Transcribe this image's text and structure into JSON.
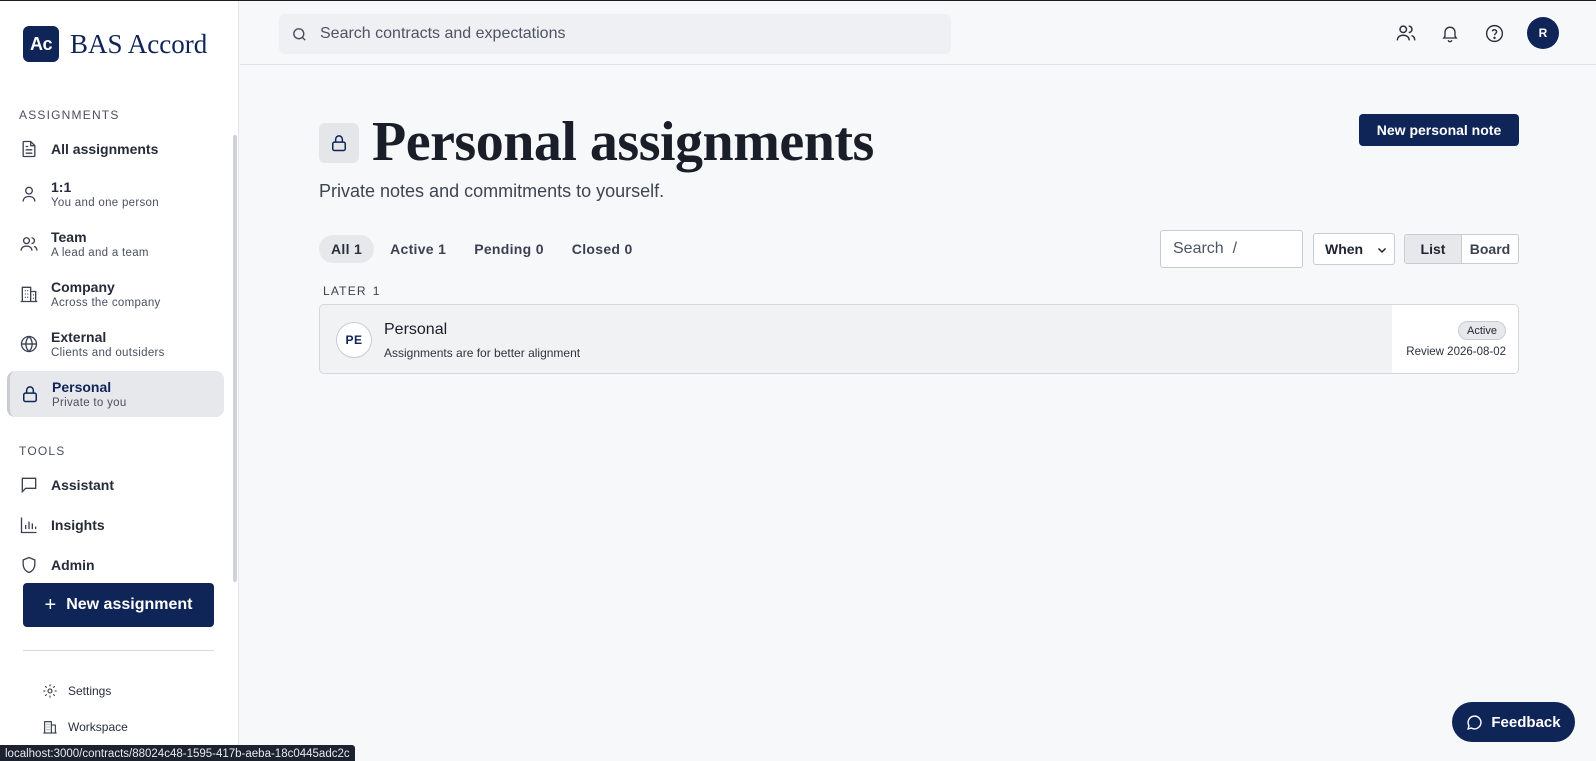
{
  "brand": {
    "logo_text": "Ac",
    "name": "BAS Accord"
  },
  "sidebar": {
    "assignments_label": "ASSIGNMENTS",
    "items": [
      {
        "title": "All assignments",
        "sub": ""
      },
      {
        "title": "1:1",
        "sub": "You and one person"
      },
      {
        "title": "Team",
        "sub": "A lead and a team"
      },
      {
        "title": "Company",
        "sub": "Across the company"
      },
      {
        "title": "External",
        "sub": "Clients and outsiders"
      },
      {
        "title": "Personal",
        "sub": "Private to you"
      }
    ],
    "tools_label": "TOOLS",
    "tools": [
      {
        "title": "Assistant"
      },
      {
        "title": "Insights"
      },
      {
        "title": "Admin"
      }
    ],
    "new_assignment": "New assignment",
    "footer": [
      {
        "title": "Settings"
      },
      {
        "title": "Workspace"
      }
    ]
  },
  "topbar": {
    "search_placeholder": "Search contracts and expectations",
    "avatar_initial": "R"
  },
  "page": {
    "title": "Personal assignments",
    "subtitle": "Private notes and commitments to yourself.",
    "primary_button": "New personal note",
    "filters": [
      "All 1",
      "Active 1",
      "Pending 0",
      "Closed 0"
    ],
    "search_placeholder": "Search  /",
    "when_select": "When",
    "view_list": "List",
    "view_board": "Board",
    "group": {
      "label": "LATER",
      "count": "1"
    },
    "card": {
      "initials": "PE",
      "title": "Personal",
      "subtitle": "Assignments are for better alignment",
      "status": "Active",
      "review": "Review 2026-08-02"
    }
  },
  "feedback": "Feedback",
  "status_url": "localhost:3000/contracts/88024c48-1595-417b-aeba-18c0445adc2c",
  "colors": {
    "brand": "#0f2557",
    "background": "#f7f8fa",
    "active_nav": "#e7e8eb"
  }
}
